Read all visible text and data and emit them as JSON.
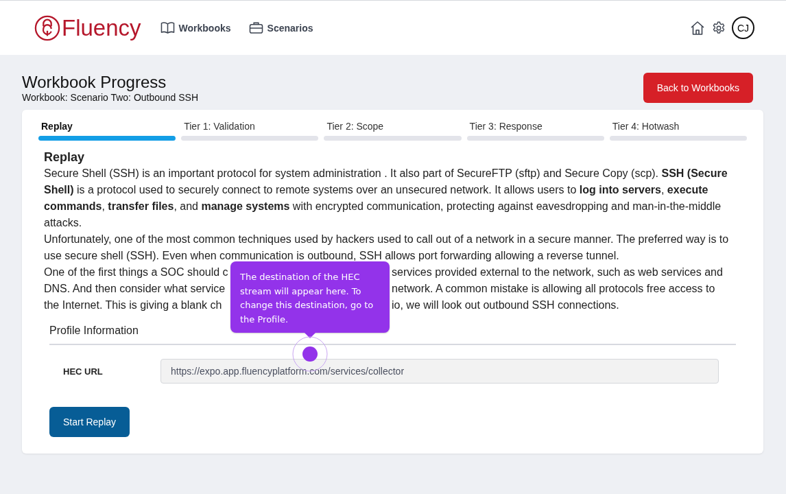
{
  "header": {
    "logo": "Fluency",
    "nav": [
      {
        "label": "Workbooks"
      },
      {
        "label": "Scenarios"
      }
    ],
    "avatar": "CJ"
  },
  "page": {
    "title": "Workbook Progress",
    "subtitle": "Workbook: Scenario Two: Outbound SSH",
    "back_button": "Back to Workbooks"
  },
  "tabs": [
    {
      "label": "Replay",
      "selected": true
    },
    {
      "label": "Tier 1: Validation",
      "selected": false
    },
    {
      "label": "Tier 2: Scope",
      "selected": false
    },
    {
      "label": "Tier 3: Response",
      "selected": false
    },
    {
      "label": "Tier 4: Hotwash",
      "selected": false
    }
  ],
  "content": {
    "heading": "Replay",
    "paragraphs": [
      "Secure Shell (SSH) is an important protocol for system administration . It also part of SecureFTP (sftp) and Secure Copy (scp). **SSH (Secure Shell)** is a protocol used to securely connect to remote systems over an unsecured network. It allows users to **log into servers**, **execute commands**, **transfer files**, and **manage systems** with encrypted communication, protecting against eavesdropping and man-in-the-middle attacks.",
      "Unfortunately, one of the most common techniques used by hackers used to call out of a network in a secure manner. The preferred way is to use secure shell (SSH). Even when communication is outbound, SSH allows port forwarding allowing a reverse tunnel."
    ],
    "covered_lines": [
      {
        "left": "One of the first things a SOC should c",
        "right": "services provided external to the network, such as web services and"
      },
      {
        "left": "DNS. And then consider what service",
        "right": "network. A common mistake is allowing all protocols free access to"
      },
      {
        "left": "the Internet. This is giving a blank ch",
        "right": "io, we will look out outbound SSH connections."
      }
    ]
  },
  "profile": {
    "title": "Profile Information",
    "fields": [
      {
        "label": "HEC URL",
        "value": "https://expo.app.fluencyplatform.com/services/collector"
      }
    ]
  },
  "start_button": "Start Replay",
  "tooltip": {
    "text": "The destination of the HEC stream will appear here.  To change this destination, go to the Profile."
  }
}
